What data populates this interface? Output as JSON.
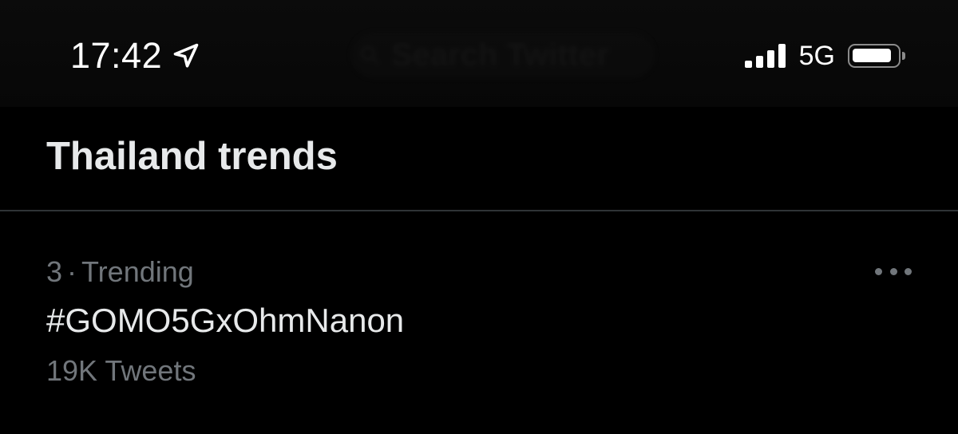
{
  "status_bar": {
    "time": "17:42",
    "network": "5G",
    "location_icon": "location-arrow-icon",
    "signal_icon": "cellular-signal-icon",
    "battery_icon": "battery-icon"
  },
  "search": {
    "placeholder": "Search Twitter",
    "icon": "search-icon"
  },
  "section": {
    "title": "Thailand trends"
  },
  "trends": [
    {
      "rank": "3",
      "separator": "·",
      "context": "Trending",
      "name": "#GOMO5GxOhmNanon",
      "count": "19K Tweets",
      "more_icon": "more-horizontal-icon"
    }
  ],
  "colors": {
    "background": "#000000",
    "primary_text": "#e7e9ea",
    "secondary_text": "#71767b",
    "divider": "#2f3336"
  }
}
